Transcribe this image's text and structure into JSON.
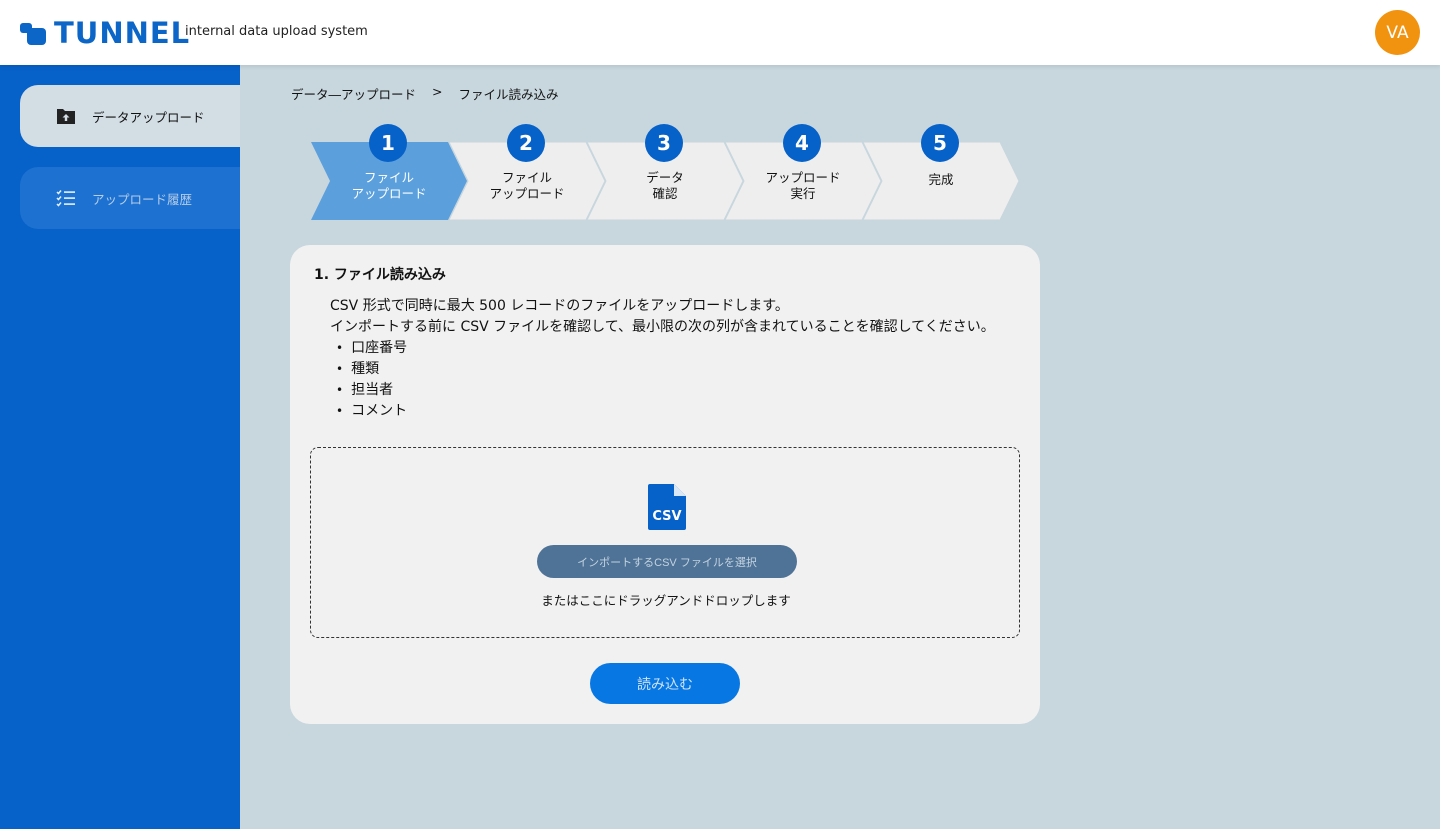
{
  "header": {
    "logo_text": "TUNNEL",
    "tagline": "internal data upload system",
    "avatar_initials": "VA"
  },
  "sidebar": {
    "items": [
      {
        "label": "データアップロード",
        "icon": "folder-upload-icon",
        "active": true
      },
      {
        "label": "アップロード履歴",
        "icon": "checklist-icon",
        "active": false
      }
    ]
  },
  "breadcrumb": {
    "items": [
      "データ―アップロード",
      "ファイル読み込み"
    ],
    "separator": ">"
  },
  "stepper": {
    "steps": [
      {
        "number": "1",
        "label": "ファイル\nアップロード",
        "active": true
      },
      {
        "number": "2",
        "label": "ファイル\nアップロード",
        "active": false
      },
      {
        "number": "3",
        "label": "データ\n確認",
        "active": false
      },
      {
        "number": "4",
        "label": "アップロード\n実行",
        "active": false
      },
      {
        "number": "5",
        "label": "完成",
        "active": false
      }
    ]
  },
  "card": {
    "title": "1. ファイル読み込み",
    "description_line1": "CSV 形式で同時に最大 500 レコードのファイルをアップロードします。",
    "description_line2": "インポートする前に CSV ファイルを確認して、最小限の次の列が含まれていることを確認してください。",
    "required_columns": [
      "口座番号",
      "種類",
      "担当者",
      "コメント"
    ],
    "dropzone": {
      "icon": "csv-file-icon",
      "select_button_label": "インポートするCSV ファイルを選択",
      "drop_text": "またはここにドラッグアンドドロップします"
    },
    "read_button_label": "読み込む"
  },
  "colors": {
    "primary": "#0661c8",
    "active_step": "#5ba0dc",
    "avatar": "#f2930f",
    "background": "#c8d6de"
  }
}
